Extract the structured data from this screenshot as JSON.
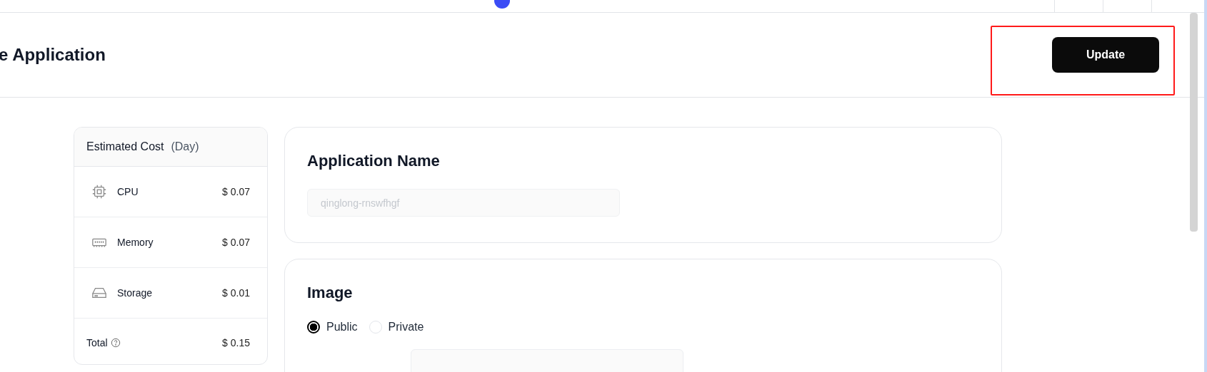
{
  "header": {
    "title": "e Application",
    "update_button": "Update"
  },
  "cost": {
    "title": "Estimated Cost",
    "period": "(Day)",
    "items": [
      {
        "kind": "cpu",
        "label": "CPU",
        "amount": "$ 0.07"
      },
      {
        "kind": "memory",
        "label": "Memory",
        "amount": "$ 0.07"
      },
      {
        "kind": "storage",
        "label": "Storage",
        "amount": "$ 0.01"
      }
    ],
    "total": {
      "label": "Total",
      "amount": "$ 0.15"
    }
  },
  "app_name": {
    "title": "Application Name",
    "placeholder": "qinglong-rnswfhgf"
  },
  "image": {
    "title": "Image",
    "options": [
      {
        "label": "Public",
        "selected": true
      },
      {
        "label": "Private",
        "selected": false
      }
    ]
  }
}
